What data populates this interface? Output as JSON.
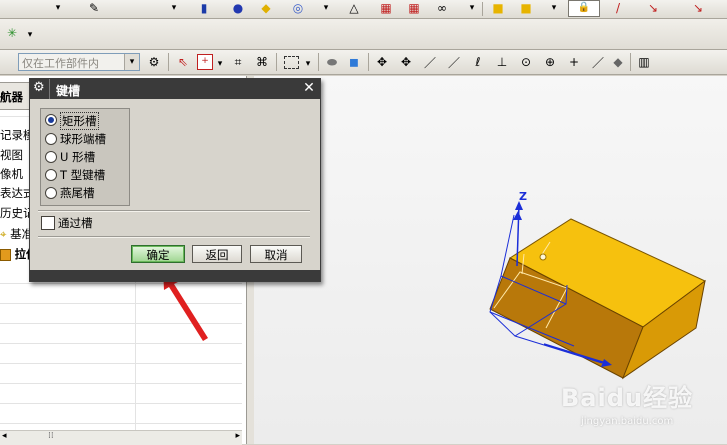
{
  "toolbar2": {
    "filter_value": "仅在工作部件内"
  },
  "navigator": {
    "tab_label": "航器",
    "rows": [
      "记录模",
      "视图",
      "像机",
      "表达式",
      "历史记",
      "基准",
      "拉伸"
    ]
  },
  "dialog": {
    "title": "键槽",
    "options": [
      {
        "label": "矩形槽",
        "selected": true
      },
      {
        "label": "球形端槽",
        "selected": false
      },
      {
        "label": "U 形槽",
        "selected": false
      },
      {
        "label": "T 型键槽",
        "selected": false
      },
      {
        "label": "燕尾槽",
        "selected": false
      }
    ],
    "through_slot_label": "通过槽",
    "ok_label": "确定",
    "back_label": "返回",
    "cancel_label": "取消"
  },
  "viewport": {
    "axis_z_label": "Z"
  },
  "watermark": {
    "brand": "Baidu经验",
    "url": "jingyan.baidu.com"
  },
  "colors": {
    "dialog_title_bg": "#3a3a3a",
    "block_top": "#f6c10e",
    "block_front": "#b8780a",
    "block_side": "#d99a06",
    "axis": "#1b2ed8",
    "arrow": "#e02020"
  }
}
